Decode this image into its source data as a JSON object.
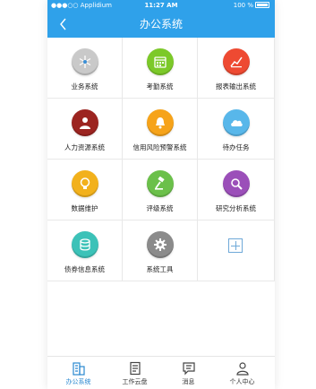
{
  "colors": {
    "brand": "#2fa1ea",
    "active_tab": "#2a88d0"
  },
  "status_bar": {
    "carrier": "●●●○○ Applidium",
    "time": "11:27 AM",
    "battery_percent": "100 %"
  },
  "nav": {
    "back_icon": "chevron-left-icon",
    "title": "办公系统"
  },
  "tiles": [
    {
      "label": "业务系统",
      "icon": "snowflake-icon",
      "color": "#c9c9c9"
    },
    {
      "label": "考勤系统",
      "icon": "calendar-icon",
      "color": "#7cc929"
    },
    {
      "label": "报表输出系统",
      "icon": "report-chart-icon",
      "color": "#ee4a32"
    },
    {
      "label": "人力资源系统",
      "icon": "person-icon",
      "color": "#9c2420"
    },
    {
      "label": "信用风险预警系统",
      "icon": "bell-icon",
      "color": "#f6a31a"
    },
    {
      "label": "待办任务",
      "icon": "cloud-icon",
      "color": "#58b7ea"
    },
    {
      "label": "数据维护",
      "icon": "bulb-icon",
      "color": "#f2b11c"
    },
    {
      "label": "评级系统",
      "icon": "gavel-icon",
      "color": "#6bc04a"
    },
    {
      "label": "研究分析系统",
      "icon": "magnifier-icon",
      "color": "#9b4fb9"
    },
    {
      "label": "债券信息系统",
      "icon": "coins-icon",
      "color": "#3cc2b8"
    },
    {
      "label": "系统工具",
      "icon": "gear-icon",
      "color": "#8b8b8b"
    }
  ],
  "add_tile": {
    "icon": "add-icon"
  },
  "tabbar": [
    {
      "label": "办公系统",
      "icon": "building-icon",
      "active": true
    },
    {
      "label": "工作云盘",
      "icon": "document-icon",
      "active": false
    },
    {
      "label": "消息",
      "icon": "message-icon",
      "active": false
    },
    {
      "label": "个人中心",
      "icon": "user-icon",
      "active": false
    }
  ]
}
